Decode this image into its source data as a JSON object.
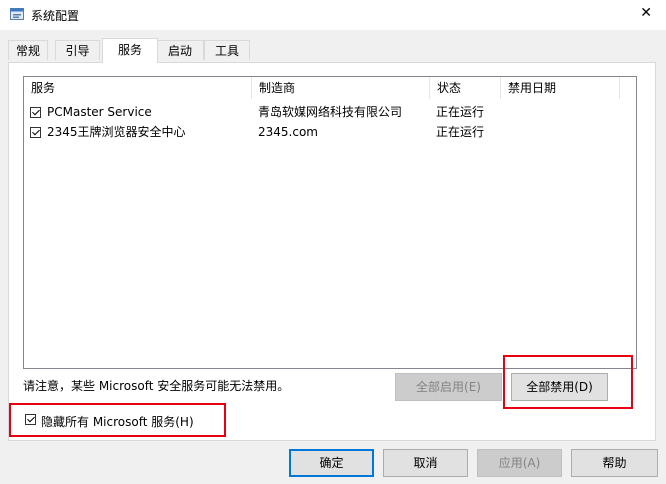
{
  "window": {
    "title": "系统配置"
  },
  "tabs": [
    {
      "label": "常规"
    },
    {
      "label": "引导"
    },
    {
      "label": "服务"
    },
    {
      "label": "启动"
    },
    {
      "label": "工具"
    }
  ],
  "services": {
    "columns": [
      "服务",
      "制造商",
      "状态",
      "禁用日期"
    ],
    "rows": [
      {
        "name": "PCMaster Service",
        "maker": "青岛软媒网络科技有限公司",
        "status": "正在运行",
        "checked": true
      },
      {
        "name": "2345王牌浏览器安全中心",
        "maker": "2345.com",
        "status": "正在运行",
        "checked": true
      }
    ]
  },
  "notice": "请注意，某些 Microsoft 安全服务可能无法禁用。",
  "buttons": {
    "enable_all": "全部启用(E)",
    "disable_all": "全部禁用(D)",
    "ok": "确定",
    "cancel": "取消",
    "apply": "应用(A)",
    "help": "帮助"
  },
  "hide_ms": {
    "label": "隐藏所有 Microsoft 服务(H)",
    "checked": true
  },
  "colors": {
    "highlight_box": "#e60012",
    "default_button_border": "#0078d7"
  },
  "icons": {
    "app": "msconfig-icon",
    "close": "close-icon"
  }
}
